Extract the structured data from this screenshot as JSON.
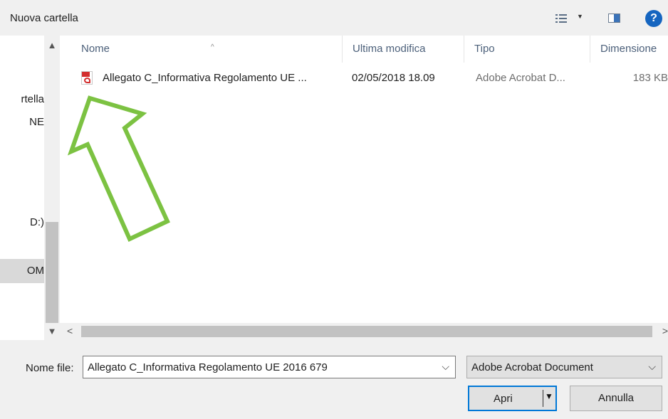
{
  "toolbar": {
    "new_folder_label": "Nuova cartella",
    "help_label": "?"
  },
  "nav": {
    "items": [
      {
        "label": "rtella"
      },
      {
        "label": "NE"
      },
      {
        "label": "D:)"
      },
      {
        "label": "OM"
      }
    ]
  },
  "file_list": {
    "columns": {
      "name": "Nome",
      "modified": "Ultima modifica",
      "type": "Tipo",
      "size": "Dimensione"
    },
    "rows": [
      {
        "name": "Allegato C_Informativa Regolamento UE ...",
        "modified": "02/05/2018 18.09",
        "type": "Adobe Acrobat D...",
        "size": "183 KB"
      }
    ]
  },
  "bottom": {
    "filename_label": "Nome file:",
    "filename_value": "Allegato C_Informativa Regolamento UE 2016 679",
    "filetype_value": "Adobe Acrobat Document",
    "open_label": "Apri",
    "cancel_label": "Annulla"
  },
  "colors": {
    "accent": "#0078d7",
    "annotation": "#7cc242"
  },
  "icons": {
    "views": "views-icon",
    "preview": "preview-pane-icon",
    "help": "help-icon",
    "file": "pdf-icon"
  }
}
